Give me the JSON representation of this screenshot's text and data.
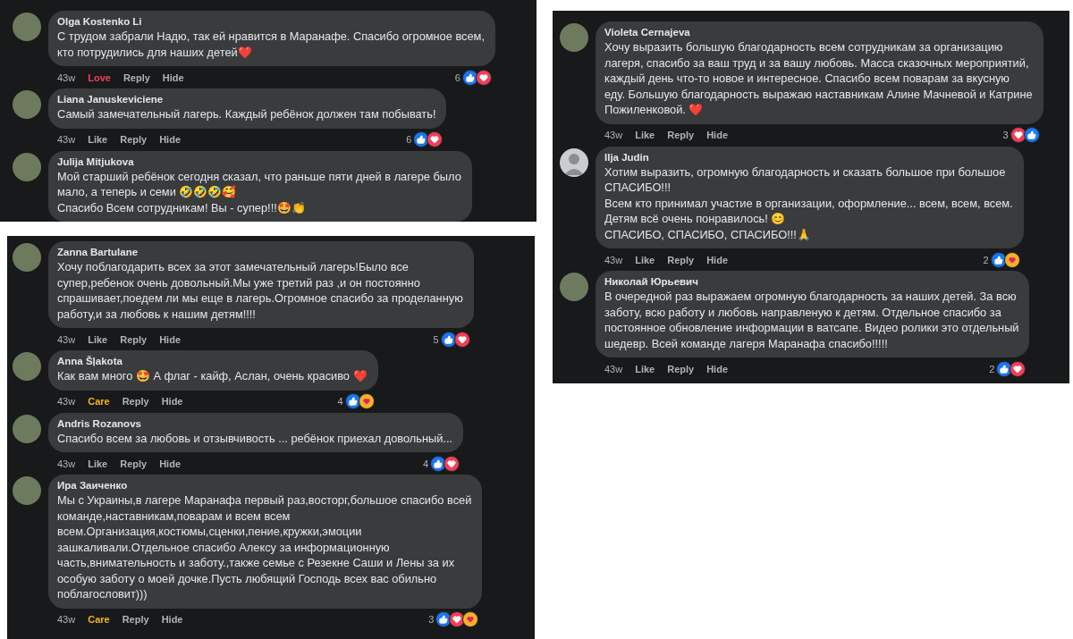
{
  "panels": [
    {
      "comments": [
        {
          "name": "Olga Kostenko Li",
          "avatar": {
            "kind": "photo"
          },
          "text": "С трудом забрали Надю, так ей нравится в Маранафе. Спасибо огромное всем,\nкто потрудились для наших детей❤️",
          "actions": {
            "time": "43w",
            "reaction": {
              "label": "Love",
              "kind": "love"
            },
            "reply": "Reply",
            "hide": "Hide",
            "count": "6",
            "icons": [
              {
                "kind": "like"
              },
              {
                "kind": "love"
              }
            ]
          }
        },
        {
          "name": "Liana Januskeviciene",
          "avatar": {
            "kind": "photo"
          },
          "text": "Самый замечательный лагерь. Каждый ребёнок должен там побывать!",
          "actions": {
            "time": "43w",
            "reaction": {
              "label": "Like",
              "kind": "none"
            },
            "reply": "Reply",
            "hide": "Hide",
            "count": "6",
            "icons": [
              {
                "kind": "like"
              },
              {
                "kind": "love"
              }
            ]
          }
        },
        {
          "name": "Julija Mitjukova",
          "avatar": {
            "kind": "photo"
          },
          "text": "Мой старший ребёнок сегодня сказал, что раньше пяти дней в лагере было\nмало, а теперь и семи 🤣🤣🤣🥰\nСпасибо Всем сотрудникам! Вы - супер!!!🤩👏"
        }
      ]
    },
    {
      "comments": [
        {
          "name": "Zanna Bartulane",
          "avatar": {
            "kind": "photo"
          },
          "text": "Хочу поблагодарить всех за этот замечательный лагерь!Было все\nсупер,ребенок очень довольный.Мы уже третий раз ,и он постоянно\nспрашивает,поедем ли мы еще в лагерь.Огромное спасибо за проделанную\nработу,и за любовь к нашим детям!!!!",
          "actions": {
            "time": "43w",
            "reaction": {
              "label": "Like",
              "kind": "none"
            },
            "reply": "Reply",
            "hide": "Hide",
            "count": "5",
            "icons": [
              {
                "kind": "like"
              },
              {
                "kind": "love"
              }
            ]
          }
        },
        {
          "name": "Anna Šļakota",
          "avatar": {
            "kind": "photo"
          },
          "text": "Как вам много 🤩 А флаг - кайф, Аслан, очень красиво ❤️",
          "actions": {
            "time": "43w",
            "reaction": {
              "label": "Care",
              "kind": "care"
            },
            "reply": "Reply",
            "hide": "Hide",
            "count": "4",
            "icons": [
              {
                "kind": "like"
              },
              {
                "kind": "care"
              }
            ]
          }
        },
        {
          "name": "Andris Rozanovs",
          "avatar": {
            "kind": "photo"
          },
          "text": "Спасибо всем за любовь и отзывчивость ... ребёнок приехал довольный...",
          "actions": {
            "time": "43w",
            "reaction": {
              "label": "Like",
              "kind": "none"
            },
            "reply": "Reply",
            "hide": "Hide",
            "count": "4",
            "icons": [
              {
                "kind": "like"
              },
              {
                "kind": "love"
              }
            ]
          }
        },
        {
          "name": "Ира Заиченко",
          "avatar": {
            "kind": "photo"
          },
          "text": "Мы с Украины,в лагере Маранафа первый раз,восторг,большое спасибо всей\nкоманде,наставникам,поварам и всем всем\nвсем.Организация,костюмы,сценки,пение,кружки,эмоции\nзашкаливали.Отдельное спасибо Алексу за информационную\nчасть,внимательность и заботу.,также семье с Резекне Саши и Лены за их\nособую заботу о моей дочке.Пусть любящий Господь всех вас обильно\nпоблагословит)))",
          "actions": {
            "time": "43w",
            "reaction": {
              "label": "Care",
              "kind": "care"
            },
            "reply": "Reply",
            "hide": "Hide",
            "count": "3",
            "icons": [
              {
                "kind": "like"
              },
              {
                "kind": "love"
              },
              {
                "kind": "care"
              }
            ]
          }
        }
      ]
    },
    {
      "comments": [
        {
          "name": "Violeta Cernajeva",
          "avatar": {
            "kind": "photo"
          },
          "text": "Хочу выразить большую благодарность всем сотрудникам за организацию\nлагеря, спасибо за ваш труд и за вашу любовь. Масса сказочных мероприятий,\nкаждый день что-то новое и интересное. Спасибо всем поварам за вкусную\nеду. Большую благодарность выражаю наставникам Алине Мачневой и Катрине\nПожиленковой. ❤️",
          "actions": {
            "time": "43w",
            "reaction": {
              "label": "Like",
              "kind": "none"
            },
            "reply": "Reply",
            "hide": "Hide",
            "count": "3",
            "icons": [
              {
                "kind": "love"
              },
              {
                "kind": "like"
              }
            ]
          }
        },
        {
          "name": "Ilja Judin",
          "avatar": {
            "kind": "silhouette"
          },
          "text": "Хотим выразить, огромную благодарность и сказать большое при большое\nСПАСИБО!!!\nВсем кто принимал участие в организации, оформление... всем, всем, всем.\nДетям всё очень понравилось! 😊\nСПАСИБО, СПАСИБО, СПАСИБО!!!🙏",
          "actions": {
            "time": "43w",
            "reaction": {
              "label": "Like",
              "kind": "none"
            },
            "reply": "Reply",
            "hide": "Hide",
            "count": "2",
            "icons": [
              {
                "kind": "like"
              },
              {
                "kind": "care"
              }
            ]
          }
        },
        {
          "name": "Николай Юрьевич",
          "avatar": {
            "kind": "photo"
          },
          "text": "В очередной раз выражаем огромную благодарность за наших детей. За всю\nзаботу, всю работу и любовь направленую к детям. Отдельное спасибо за\nпостоянное обновление информации в ватсапе. Видео ролики это отдельный\nшедевр. Всей команде лагеря Маранафа спасибо!!!!!",
          "actions": {
            "time": "43w",
            "reaction": {
              "label": "Like",
              "kind": "none"
            },
            "reply": "Reply",
            "hide": "Hide",
            "count": "2",
            "icons": [
              {
                "kind": "like"
              },
              {
                "kind": "love"
              }
            ]
          }
        }
      ]
    }
  ]
}
